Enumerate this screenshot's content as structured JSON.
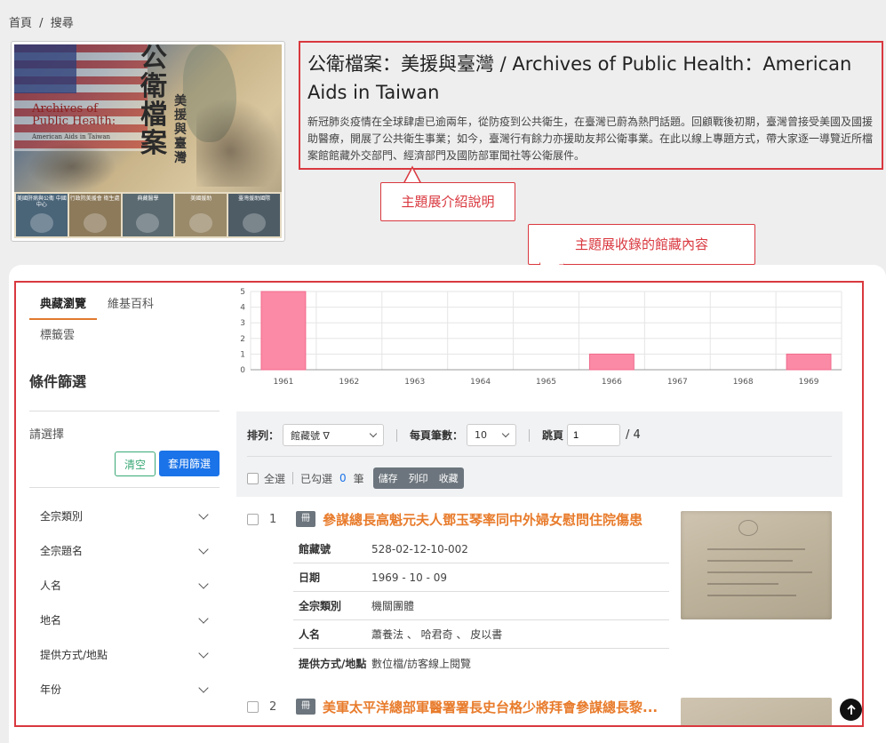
{
  "breadcrumb": {
    "home": "首頁",
    "separator": "/",
    "current": "搜尋"
  },
  "cover": {
    "title_zh": "公衛檔案",
    "subtitle_zh": "美援與臺灣",
    "title_en_1": "Archives of",
    "title_en_2": "Public Health:",
    "title_en_3": "American Aids in Taiwan",
    "tiles": [
      "美國肝病與公衛 中國中心",
      "行政院美援會 衛生處",
      "典藏醫學",
      "美國援助",
      "臺灣援助國際"
    ]
  },
  "intro": {
    "title": "公衛檔案：美援與臺灣 / Archives of Public Health：American Aids in Taiwan",
    "description": "新冠肺炎疫情在全球肆虐已逾兩年，從防疫到公共衛生，在臺灣已蔚為熱門話題。回顧戰後初期，臺灣曾接受美國及國援助醫療，開展了公共衛生事業；如今，臺灣行有餘力亦援助友邦公衛事業。在此以線上專題方式，帶大家逐一導覽近所檔案館館藏外交部門、經濟部門及國防部軍聞社等公衛展件。"
  },
  "callouts": {
    "intro": "主題展介紹說明",
    "collection": "主題展收錄的館藏內容"
  },
  "sidebar": {
    "tabs": [
      "典藏瀏覽",
      "維基百科"
    ],
    "tag_cloud": "標籤雲",
    "filter_title": "條件篩選",
    "choose": "請選擇",
    "clear": "清空",
    "apply": "套用篩選",
    "facets": [
      "全宗類別",
      "全宗題名",
      "人名",
      "地名",
      "提供方式/地點",
      "年份"
    ]
  },
  "chart_data": {
    "type": "bar",
    "categories": [
      "1961",
      "1962",
      "1963",
      "1964",
      "1965",
      "1966",
      "1967",
      "1968",
      "1969"
    ],
    "values": [
      5,
      0,
      0,
      0,
      0,
      1,
      0,
      0,
      1
    ],
    "ylim": [
      0,
      5
    ],
    "yticks": [
      "0",
      "1",
      "2",
      "3",
      "4",
      "5"
    ],
    "bar_color": "#fb8aa6",
    "grid": true
  },
  "toolbar": {
    "sort_label": "排列：",
    "sort_value": "館藏號 ∇",
    "per_page_label": "每頁筆數：",
    "per_page_value": "10",
    "jump_label": "跳頁",
    "page_value": "1",
    "total_pages": "/ 4",
    "select_all": "全選",
    "selected_prefix": "已勾選",
    "selected_count": "0",
    "selected_suffix": "筆",
    "save": "儲存",
    "print": "列印",
    "collect": "收藏"
  },
  "results": [
    {
      "num": "1",
      "badge": "冊",
      "title": "參謀總長高魁元夫人鄧玉琴率同中外婦女慰問住院傷患",
      "fields": [
        {
          "key": "館藏號",
          "value": "528-02-12-10-002"
        },
        {
          "key": "日期",
          "value": "1969 - 10 - 09"
        },
        {
          "key": "全宗類別",
          "value": "機關團體"
        },
        {
          "key": "人名",
          "value": "蕭養法 、 哈君奇 、 皮以書"
        },
        {
          "key": "提供方式/地點",
          "value": "數位檔/訪客線上閱覽"
        }
      ]
    },
    {
      "num": "2",
      "badge": "冊",
      "title": "美軍太平洋總部軍醫署署長史台格少將拜會參謀總長黎..."
    }
  ]
}
